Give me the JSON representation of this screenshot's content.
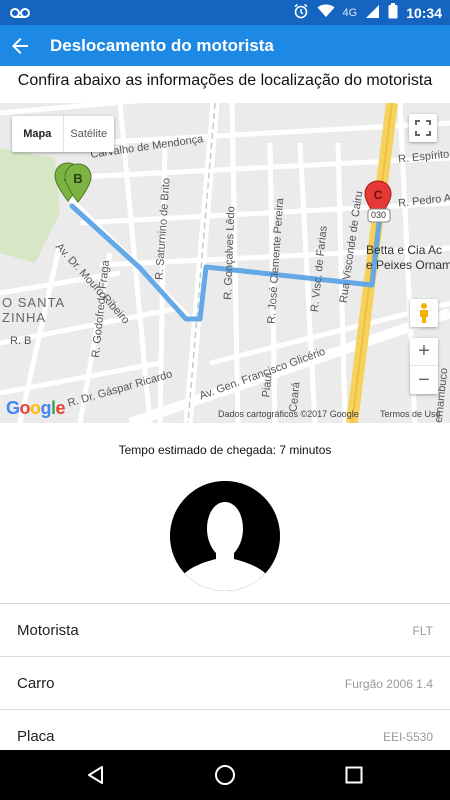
{
  "status_bar": {
    "time": "10:34",
    "network": "4G",
    "icons": [
      "voicemail-icon",
      "alarm-icon",
      "wifi-icon",
      "signal-icon",
      "battery-icon"
    ]
  },
  "app_bar": {
    "title": "Deslocamento do motorista",
    "back_icon": "arrow-back-icon",
    "color": "#1e88e5"
  },
  "subtitle": "Confira abaixo as informações de localização do motorista",
  "map": {
    "type_control": {
      "map_label": "Mapa",
      "satellite_label": "Satélite"
    },
    "markers": [
      {
        "label": "A",
        "color": "#7cb342"
      },
      {
        "label": "B",
        "color": "#7cb342"
      },
      {
        "label": "C",
        "color": "#e53935"
      }
    ],
    "street_labels": [
      "Carvalho de Mendonça",
      "Av. Dr. Mouro Ribeiro",
      "R. Saturnino de Brito",
      "R. Gonçalves Lêdo",
      "R. José Clemente Pereira",
      "R. Visc. de Farias",
      "Rua Visconde de Cairu",
      "R. Godofredo Fraga",
      "R. Dr. Gáspar Ricardo",
      "Av. Gen. Francisco Glicério",
      "R. Pedro A",
      "R. Espírito",
      "R. B",
      "Piauí",
      "Ceará",
      "Pernambuco"
    ],
    "area_label_1": "O SANTA",
    "area_label_2": "ZINHA",
    "business_label_1": "Betta e Cia Ac",
    "business_label_2": "e Peixes Ornam",
    "road_badge": "030",
    "footer": {
      "data_text": "Dados cartográficos ©2017 Google",
      "terms_text": "Termos de Uso",
      "logo": "Google"
    },
    "controls": {
      "fullscreen_icon": "fullscreen-icon",
      "pegman_icon": "pegman-icon",
      "zoom_in": "+",
      "zoom_out": "−"
    },
    "route_color": "#64a8e8"
  },
  "eta_text": "Tempo estimado de chegada: 7 minutos",
  "avatar_icon": "person-silhouette-icon",
  "details": [
    {
      "label": "Motorista",
      "value": "FLT"
    },
    {
      "label": "Carro",
      "value": "Furgão 2006 1.4"
    },
    {
      "label": "Placa",
      "value": "EEI-5530"
    }
  ],
  "nav_bar": {
    "back_icon": "nav-back-icon",
    "home_icon": "nav-home-icon",
    "recents_icon": "nav-recents-icon"
  }
}
